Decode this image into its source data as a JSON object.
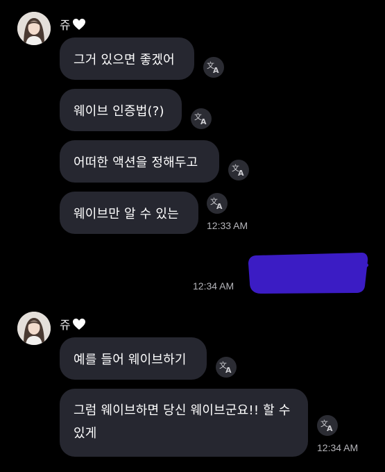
{
  "colors": {
    "background": "#000000",
    "bubble_incoming": "#262730",
    "bubble_outgoing": "#3b1cc4",
    "timestamp": "#b6b6bb",
    "translate_button": "#2b2c33"
  },
  "icons": {
    "heart": "white-heart-icon",
    "translate": "translate-icon"
  },
  "groups": [
    {
      "sender": "쥬",
      "messages": [
        {
          "text": "그거 있으면 좋겠어"
        },
        {
          "text": "웨이브 인증법(?)"
        },
        {
          "text": "어떠한 액션을 정해두고"
        },
        {
          "text": "웨이브만 알 수 있는",
          "time": "12:33 AM"
        }
      ]
    },
    {
      "outgoing": true,
      "time": "12:34 AM"
    },
    {
      "sender": "쥬",
      "messages": [
        {
          "text": "예를 들어 웨이브하기"
        },
        {
          "text": "그럼 웨이브하면 당신 웨이브군요!! 할 수 있게",
          "time": "12:34 AM"
        }
      ]
    }
  ]
}
